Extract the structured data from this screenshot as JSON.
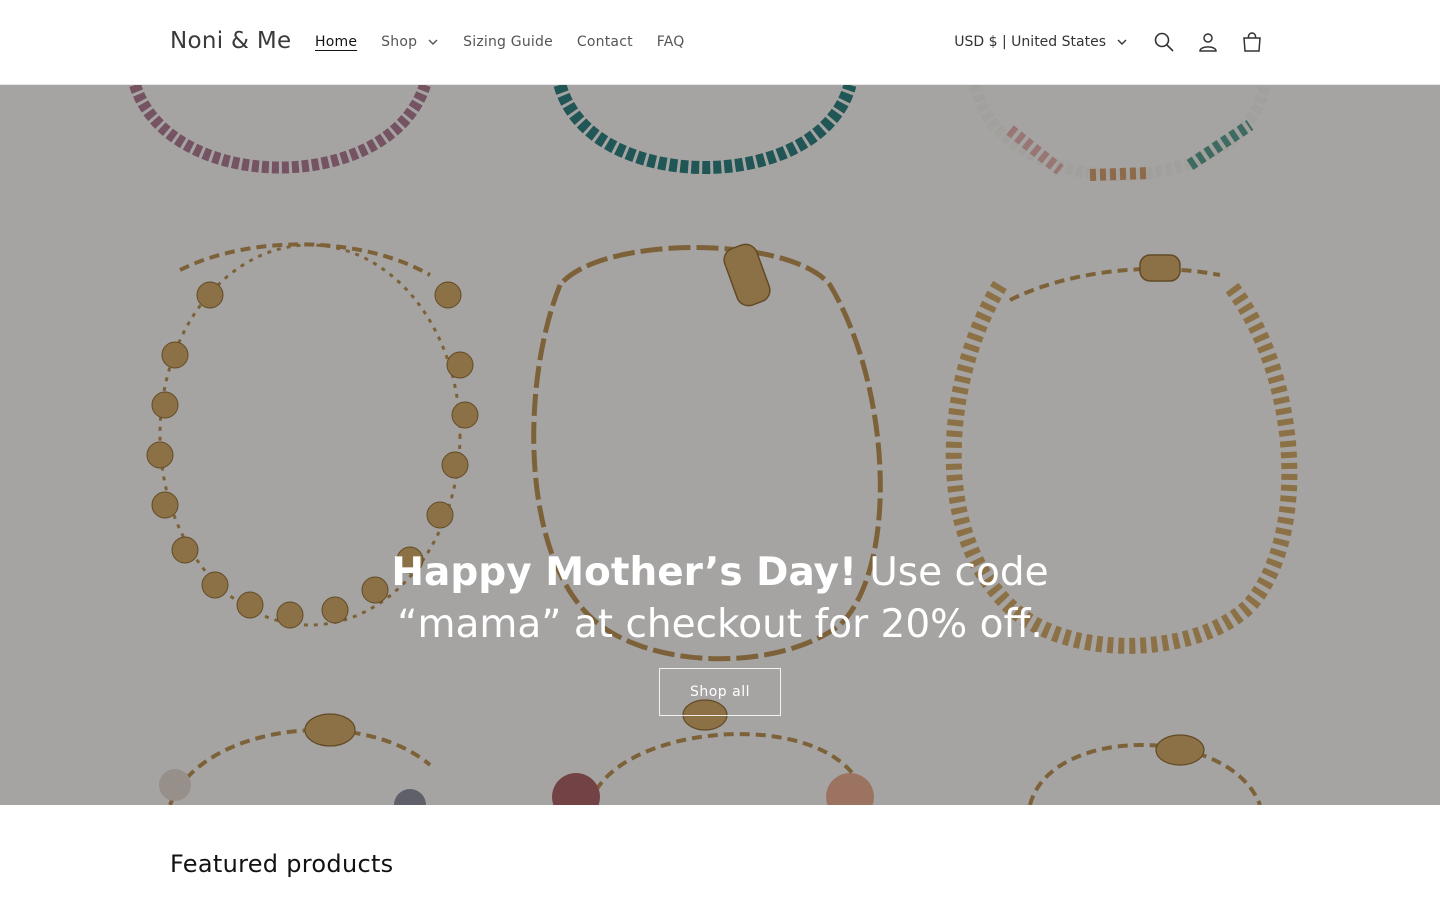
{
  "header": {
    "logo": "Noni & Me",
    "nav": [
      {
        "label": "Home",
        "active": true
      },
      {
        "label": "Shop",
        "dropdown": true
      },
      {
        "label": "Sizing Guide"
      },
      {
        "label": "Contact"
      },
      {
        "label": "FAQ"
      }
    ],
    "currency": "USD $ | United States",
    "icons": [
      "search-icon",
      "account-icon",
      "cart-icon"
    ]
  },
  "hero": {
    "headline_bold": "Happy Mother’s Day!",
    "headline_rest": " Use code “mama” at checkout for 20% off.",
    "button_label": "Shop all"
  },
  "featured": {
    "title": "Featured products"
  },
  "colors": {
    "text": "#121212",
    "overlay": "rgba(0,0,0,0.30)",
    "background": "#ffffff"
  }
}
